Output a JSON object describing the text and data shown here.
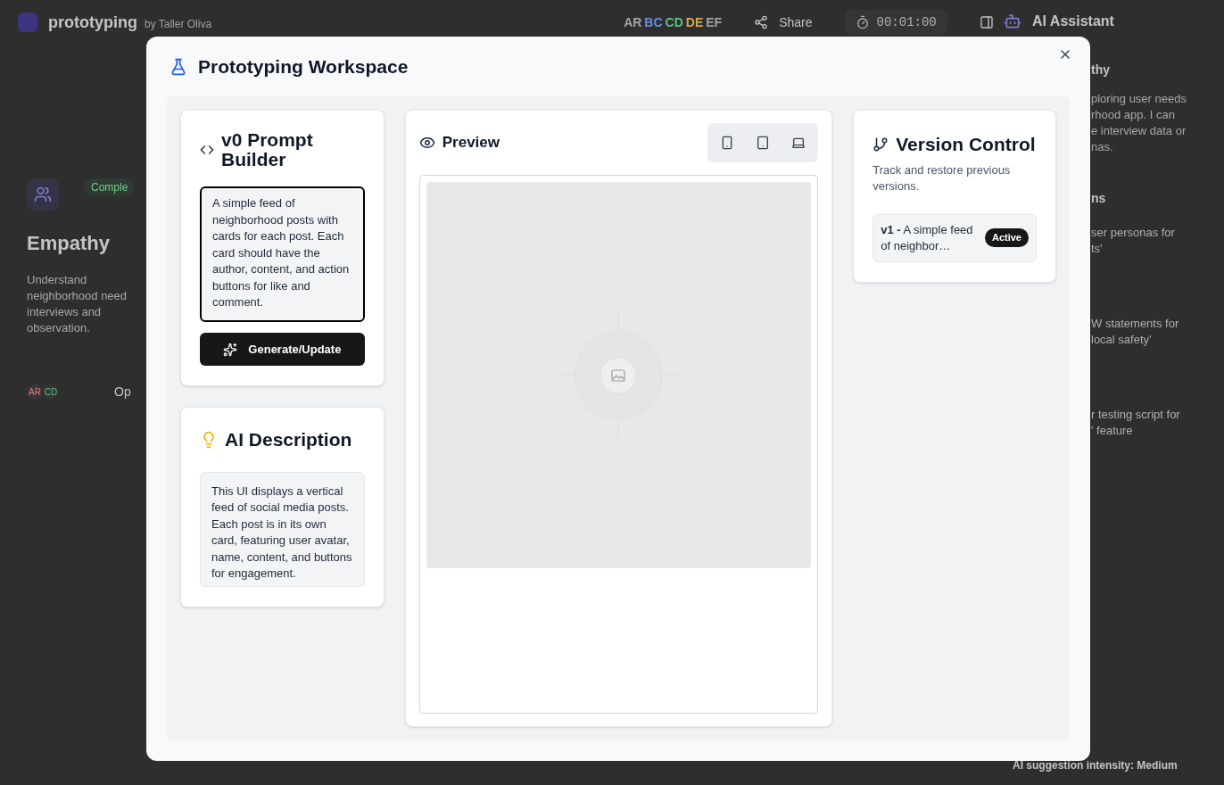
{
  "header": {
    "app_name": "prototyping",
    "byline": "by Taller Oliva",
    "collaborators": [
      {
        "initials": "AR",
        "color": "#a3a3a3"
      },
      {
        "initials": "BC",
        "color": "#6b8de3"
      },
      {
        "initials": "CD",
        "color": "#5fbf7f"
      },
      {
        "initials": "DE",
        "color": "#d2ab45"
      },
      {
        "initials": "EF",
        "color": "#a3a3a3"
      }
    ],
    "share": "Share",
    "timer": "00:01:00"
  },
  "stage_card": {
    "badge": "Comple",
    "title": "Empathy",
    "description_lines": [
      "Understand",
      "neighborhood need",
      "interviews and",
      "observation."
    ],
    "members": [
      {
        "initials": "AR",
        "color": "#e07a7a"
      },
      {
        "initials": "CD",
        "color": "#5fbf7f"
      }
    ],
    "action": "Op"
  },
  "assistant": {
    "title": "AI Assistant",
    "section": "thy",
    "message_lines": [
      "ploring user needs",
      "rhood app. I can",
      "e interview data or",
      "nas."
    ],
    "suggestions_heading": "ns",
    "suggestions": [
      {
        "lines": [
          "ser personas for",
          "ts'"
        ]
      },
      {
        "lines": [
          "W statements for",
          "local safety'"
        ]
      },
      {
        "lines": [
          "r testing script for",
          "' feature"
        ]
      }
    ],
    "intensity": "AI suggestion intensity: Medium"
  },
  "modal": {
    "title": "Prototyping Workspace",
    "prompt_builder": {
      "title": "v0 Prompt Builder",
      "prompt": "A simple feed of neighborhood posts with cards for each post. Each card should have the author, content, and action buttons for like and comment.",
      "button": "Generate/Update"
    },
    "ai_description": {
      "title": "AI Description",
      "text": "This UI displays a vertical feed of social media posts. Each post is in its own card, featuring user avatar, name, content, and buttons for engagement."
    },
    "preview": {
      "title": "Preview",
      "devices": [
        {
          "kind": "mobile"
        },
        {
          "kind": "tablet"
        },
        {
          "kind": "desktop"
        }
      ]
    },
    "version_control": {
      "title": "Version Control",
      "subtitle": "Track and restore previous versions.",
      "versions": [
        {
          "label": "v1 -",
          "summary": "A simple feed of neighbor…",
          "active": true,
          "badge": "Active"
        }
      ]
    }
  }
}
